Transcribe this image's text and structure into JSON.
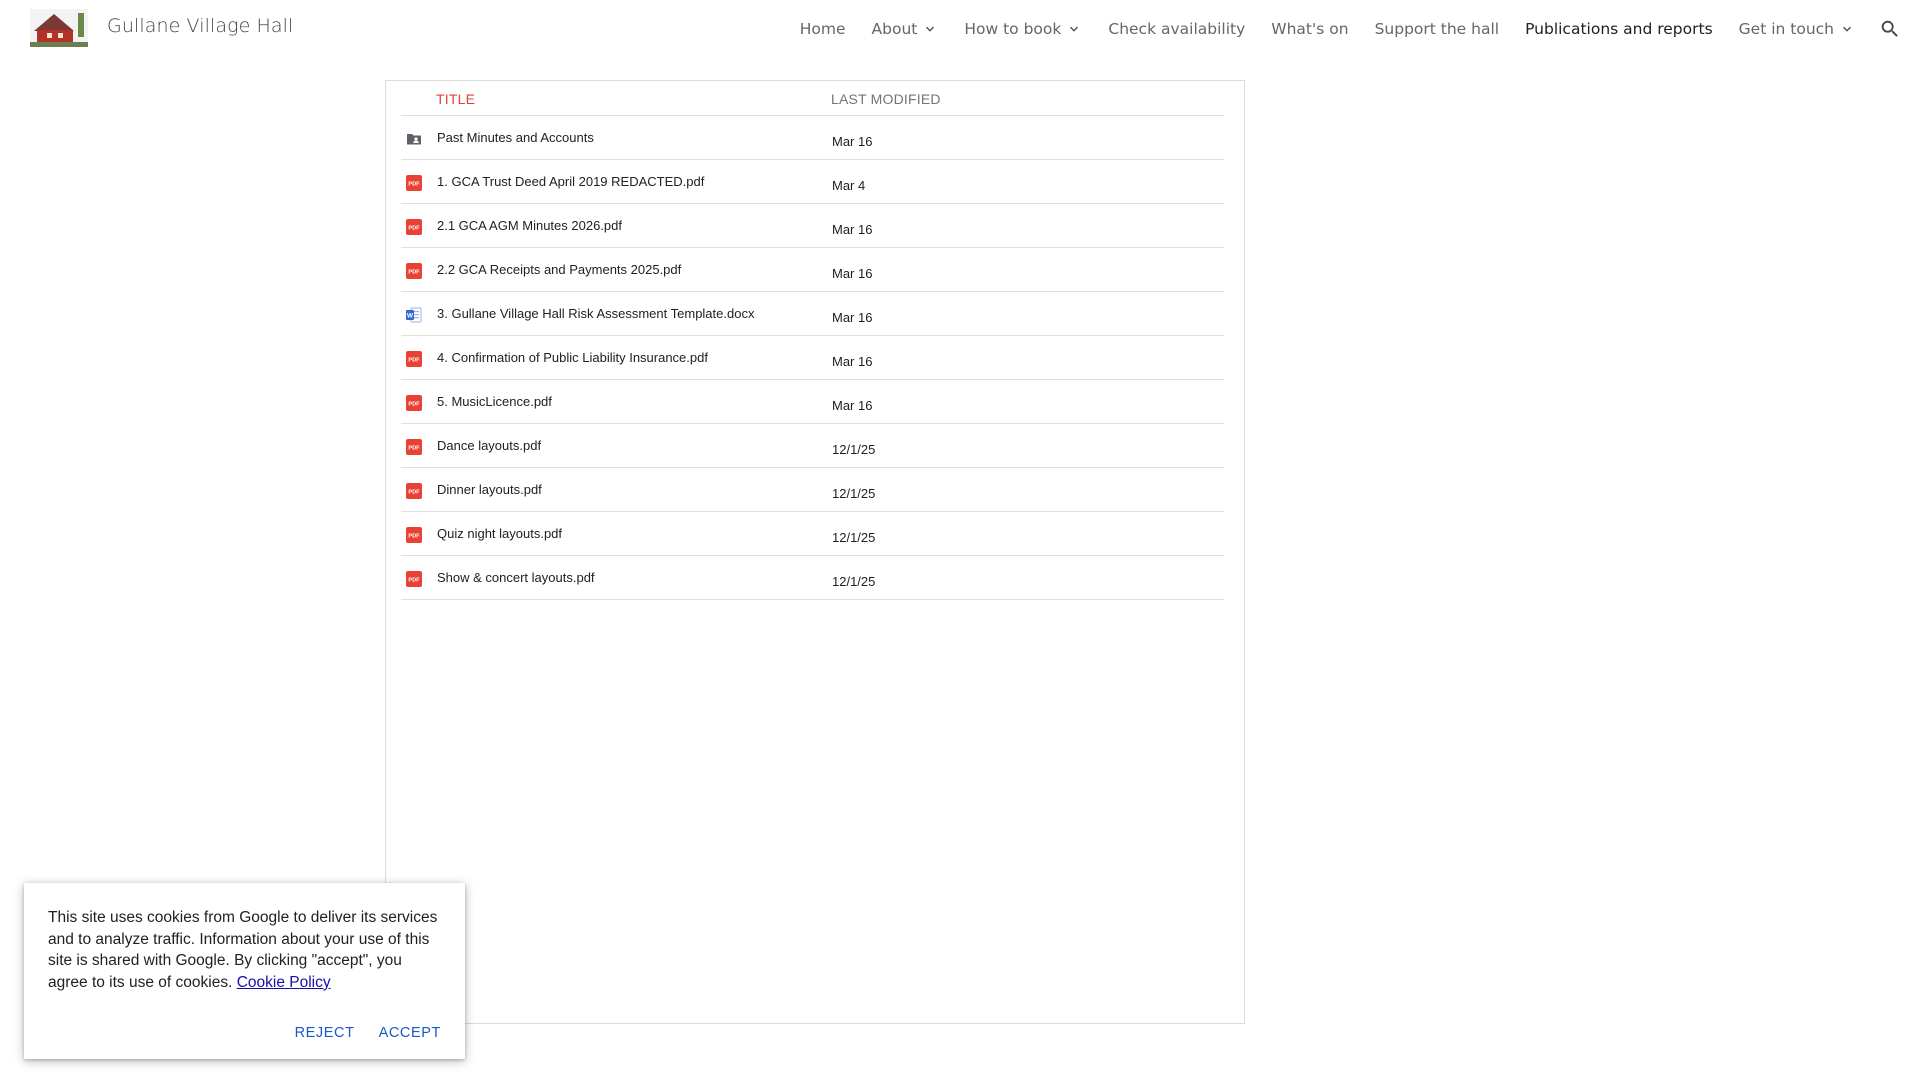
{
  "header": {
    "site_title": "Gullane Village Hall",
    "nav": [
      {
        "label": "Home",
        "has_dropdown": false,
        "active": false
      },
      {
        "label": "About",
        "has_dropdown": true,
        "active": false
      },
      {
        "label": "How to book",
        "has_dropdown": true,
        "active": false
      },
      {
        "label": "Check availability",
        "has_dropdown": false,
        "active": false
      },
      {
        "label": "What's on",
        "has_dropdown": false,
        "active": false
      },
      {
        "label": "Support the hall",
        "has_dropdown": false,
        "active": false
      },
      {
        "label": "Publications and reports",
        "has_dropdown": false,
        "active": true
      },
      {
        "label": "Get in touch",
        "has_dropdown": true,
        "active": false
      }
    ]
  },
  "files": {
    "col_title": "TITLE",
    "col_modified": "LAST MODIFIED",
    "rows": [
      {
        "name": "Past Minutes and Accounts",
        "modified": "Mar 16",
        "icon": "shared-folder-icon"
      },
      {
        "name": "1. GCA Trust Deed April 2019 REDACTED.pdf",
        "modified": "Mar 4",
        "icon": "pdf-icon"
      },
      {
        "name": "2.1 GCA AGM Minutes 2026.pdf",
        "modified": "Mar 16",
        "icon": "pdf-icon"
      },
      {
        "name": "2.2 GCA Receipts and Payments 2025.pdf",
        "modified": "Mar 16",
        "icon": "pdf-icon"
      },
      {
        "name": "3. Gullane Village Hall Risk Assessment Template.docx",
        "modified": "Mar 16",
        "icon": "word-doc-icon"
      },
      {
        "name": "4. Confirmation of Public Liability Insurance.pdf",
        "modified": "Mar 16",
        "icon": "pdf-icon"
      },
      {
        "name": "5. MusicLicence.pdf",
        "modified": "Mar 16",
        "icon": "pdf-icon"
      },
      {
        "name": "Dance layouts.pdf",
        "modified": "12/1/25",
        "icon": "pdf-icon"
      },
      {
        "name": "Dinner layouts.pdf",
        "modified": "12/1/25",
        "icon": "pdf-icon"
      },
      {
        "name": "Quiz night layouts.pdf",
        "modified": "12/1/25",
        "icon": "pdf-icon"
      },
      {
        "name": "Show & concert layouts.pdf",
        "modified": "12/1/25",
        "icon": "pdf-icon"
      }
    ]
  },
  "cookie": {
    "text": "This site uses cookies from Google to deliver its services and to analyze traffic. Information about your use of this site is shared with Google. By clicking \"accept\", you agree to its use of cookies.",
    "link": "Cookie Policy",
    "reject": "REJECT",
    "accept": "ACCEPT"
  },
  "colors": {
    "title_header": "#db4437",
    "pdf_red": "#e94235",
    "word_blue": "#3367d6",
    "button_blue": "#1a57c9"
  }
}
